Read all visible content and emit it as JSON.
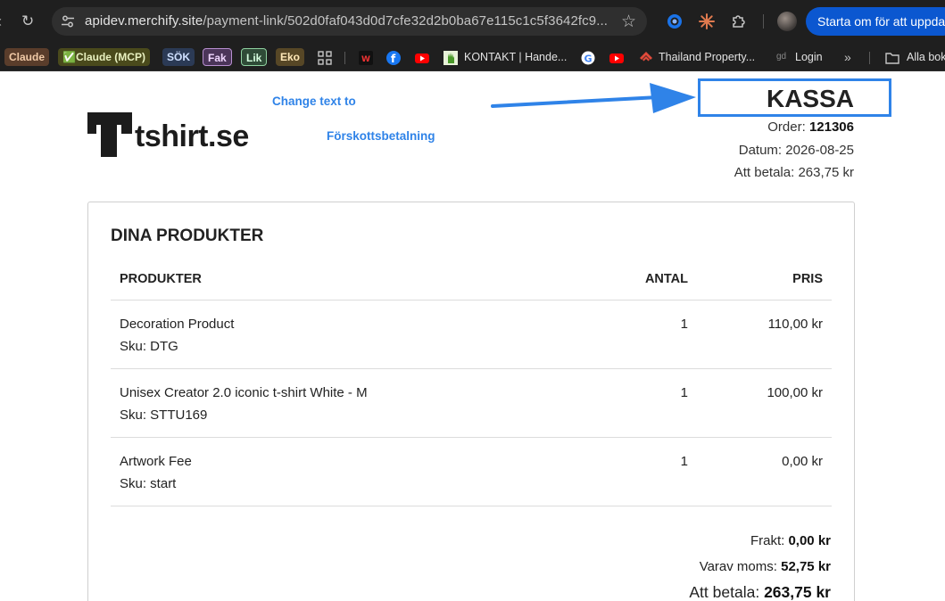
{
  "browser": {
    "url_host": "apidev.merchify.site",
    "url_path": "/payment-link/502d0faf043d0d7cfe32d2b0ba67e115c1c5f3642fc9...",
    "update_button": "Starta om för att uppda",
    "bookmarks": [
      {
        "label": "Claude",
        "color": "#f0c9a6",
        "bg": "#5a3d2b"
      },
      {
        "label": "✅Claude (MCP)",
        "color": "#e8f0c0",
        "bg": "#4a4a1c"
      },
      {
        "label": "SÖK",
        "color": "#cfe0ff",
        "bg": "#2b3a55"
      },
      {
        "label": "Fak",
        "color": "#f0d7ff",
        "bg": "#4b3559"
      },
      {
        "label": "Lik",
        "color": "#d7ffe0",
        "bg": "#2f4b37"
      },
      {
        "label": "Eko",
        "color": "#ffe8b8",
        "bg": "#574726"
      },
      {
        "label": "KONTAKT | Hande..."
      },
      {
        "label": "Thailand Property..."
      },
      {
        "label": "Login"
      },
      {
        "label": "Alla bokmärken"
      }
    ]
  },
  "annotation": {
    "line1": "Change text to",
    "line2": "Förskottsbetalning"
  },
  "header": {
    "logo_text": "tshirt.se",
    "title": "KASSA",
    "order_label": "Order:",
    "order_number": "121306",
    "date_label": "Datum:",
    "date_value": "2026-08-25",
    "to_pay_label": "Att betala:",
    "to_pay_value": "263,75 kr"
  },
  "products": {
    "heading": "DINA PRODUKTER",
    "columns": {
      "product": "PRODUKTER",
      "qty": "ANTAL",
      "price": "PRIS"
    },
    "rows": [
      {
        "name": "Decoration Product",
        "sku": "Sku: DTG",
        "qty": "1",
        "price": "110,00 kr"
      },
      {
        "name": "Unisex Creator 2.0 iconic t-shirt White - M",
        "sku": "Sku: STTU169",
        "qty": "1",
        "price": "100,00 kr"
      },
      {
        "name": "Artwork Fee",
        "sku": "Sku: start",
        "qty": "1",
        "price": "0,00 kr"
      }
    ]
  },
  "totals": {
    "shipping_label": "Frakt:",
    "shipping_value": "0,00 kr",
    "vat_label": "Varav moms:",
    "vat_value": "52,75 kr",
    "total_label": "Att betala:",
    "total_value": "263,75 kr"
  },
  "colors": {
    "annotation_blue": "#2f83e8",
    "update_button": "#0b57d0",
    "chrome_bg": "#1f1f1f"
  }
}
